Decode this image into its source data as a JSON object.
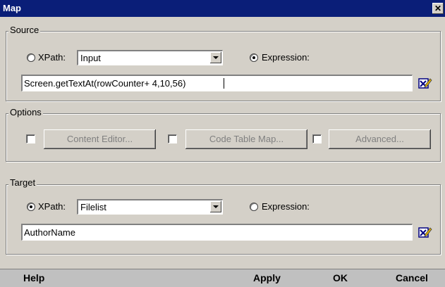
{
  "window": {
    "title": "Map",
    "close": "✕"
  },
  "source": {
    "legend": "Source",
    "xpath_label": "XPath:",
    "xpath_selected": false,
    "xpath_value": "Input",
    "expression_label": "Expression:",
    "expression_selected": true,
    "expression_value": "Screen.getTextAt(rowCounter+ 4,10,56)"
  },
  "options": {
    "legend": "Options",
    "content_editor": "Content Editor...",
    "code_table_map": "Code Table Map...",
    "advanced": "Advanced..."
  },
  "target": {
    "legend": "Target",
    "xpath_label": "XPath:",
    "xpath_selected": true,
    "xpath_value": "Filelist",
    "expression_label": "Expression:",
    "expression_selected": false,
    "text_value": "AuthorName"
  },
  "bottom": {
    "help": "Help",
    "apply": "Apply",
    "ok": "OK",
    "cancel": "Cancel"
  },
  "icons": {
    "edit": "edit-expression-icon",
    "dropdown": "dropdown-arrow-icon"
  },
  "colors": {
    "titlebar": "#0a1e78",
    "dialog_bg": "#d4d0c8",
    "bottom_bar": "#c0c0c0"
  }
}
